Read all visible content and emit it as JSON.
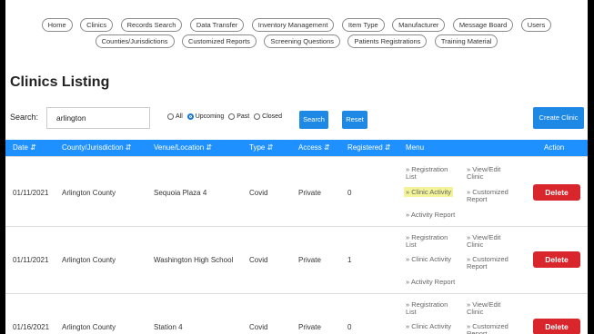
{
  "nav": {
    "row1": [
      "Home",
      "Clinics",
      "Records Search",
      "Data Transfer",
      "Inventory Management",
      "Item Type",
      "Manufacturer",
      "Message Board",
      "Users"
    ],
    "row2": [
      "Counties/Jurisdictions",
      "Customized Reports",
      "Screening Questions",
      "Patients Registrations",
      "Training Material"
    ]
  },
  "page_title": "Clinics Listing",
  "search": {
    "label": "Search:",
    "value": "arlington",
    "filters": [
      {
        "label": "All",
        "selected": false
      },
      {
        "label": "Upcoming",
        "selected": true
      },
      {
        "label": "Past",
        "selected": false
      },
      {
        "label": "Closed",
        "selected": false
      }
    ],
    "search_button": "Search",
    "reset_button": "Reset",
    "create_button": "Create Clinic"
  },
  "table": {
    "headers": {
      "date": "Date ⇵",
      "county": "County/Jurisdiction ⇵",
      "venue": "Venue/Location ⇵",
      "type": "Type ⇵",
      "access": "Access ⇵",
      "registered": "Registered ⇵",
      "menu": "Menu",
      "action": "Action"
    },
    "menu_links": {
      "registration_list": "» Registration List",
      "view_edit": "» View/Edit Clinic",
      "clinic_activity": "» Clinic Activity",
      "customized_report": "» Customized Report",
      "activity_report": "» Activity Report"
    },
    "delete_label": "Delete",
    "rows": [
      {
        "date": "01/11/2021",
        "county": "Arlington County",
        "venue": "Sequoia Plaza 4",
        "type": "Covid",
        "access": "Private",
        "registered": "0"
      },
      {
        "date": "01/11/2021",
        "county": "Arlington County",
        "venue": "Washington High School",
        "type": "Covid",
        "access": "Private",
        "registered": "1"
      },
      {
        "date": "01/16/2021",
        "county": "Arlington County",
        "venue": "Station 4",
        "type": "Covid",
        "access": "Private",
        "registered": "0"
      }
    ]
  }
}
